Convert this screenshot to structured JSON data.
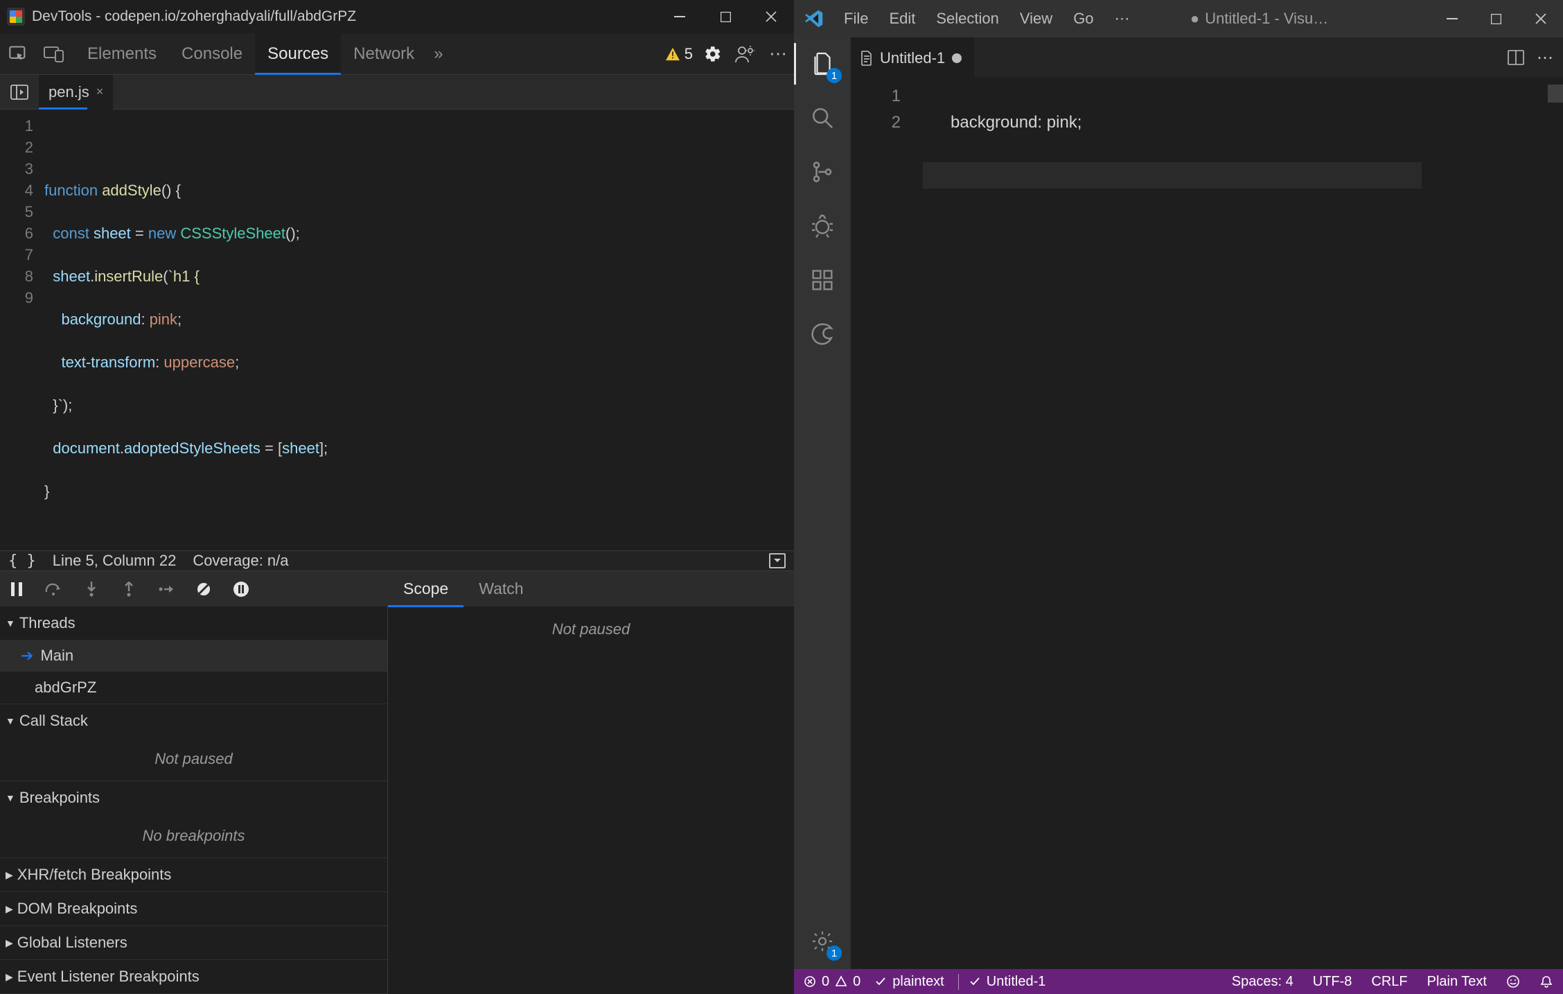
{
  "devtools": {
    "titlebar_title": "DevTools - codepen.io/zoherghadyali/full/abdGrPZ",
    "toolbar": {
      "tabs": [
        "Elements",
        "Console",
        "Sources",
        "Network"
      ],
      "active_tab": "Sources",
      "issue_count": "5",
      "more_glyph": "»"
    },
    "file_tab": "pen.js",
    "editor_lines": [
      "1",
      "2",
      "3",
      "4",
      "5",
      "6",
      "7",
      "8",
      "9"
    ],
    "code": {
      "l2_fn_kw": "function",
      "l2_fn_name": "addStyle",
      "l2_rest": "() {",
      "l3_const": "const",
      "l3_sheet": "sheet",
      "l3_eq": "=",
      "l3_new": "new",
      "l3_cls": "CSSStyleSheet",
      "l3_end": "();",
      "l4_obj": "sheet",
      "l4_dot": ".",
      "l4_fn": "insertRule",
      "l4_open": "(`",
      "l4_sel": "h1 {",
      "l5_key": "background",
      "l5_colon": ": ",
      "l5_val": "pink",
      "l5_semi": ";",
      "l6_key": "text-transform",
      "l6_colon": ": ",
      "l6_val": "uppercase",
      "l6_semi": ";",
      "l7": " }`);",
      "l8_doc": "document",
      "l8_dot": ".",
      "l8_prop": "adoptedStyleSheets",
      "l8_eq": " = [",
      "l8_sheet": "sheet",
      "l8_end": "];",
      "l9": "}"
    },
    "statusbar": {
      "braces": "{ }",
      "pos": "Line 5, Column 22",
      "coverage": "Coverage: n/a"
    },
    "scope_tabs": [
      "Scope",
      "Watch"
    ],
    "scope_msg": "Not paused",
    "panes": {
      "threads_label": "Threads",
      "threads_items": [
        "Main",
        "abdGrPZ"
      ],
      "callstack_label": "Call Stack",
      "callstack_msg": "Not paused",
      "breakpoints_label": "Breakpoints",
      "breakpoints_msg": "No breakpoints",
      "xhr_label": "XHR/fetch Breakpoints",
      "dom_label": "DOM Breakpoints",
      "global_label": "Global Listeners",
      "eventlistener_label": "Event Listener Breakpoints"
    }
  },
  "vscode": {
    "menus": [
      "File",
      "Edit",
      "Selection",
      "View",
      "Go"
    ],
    "menu_more": "⋯",
    "title_prefix": "●",
    "title_text": "Untitled-1 - Visu…",
    "file_tab": "Untitled-1",
    "activity_badge": "1",
    "gear_badge": "1",
    "editor_lines": [
      "1",
      "2"
    ],
    "code_l1": "      background: pink;",
    "status": {
      "err": "0",
      "warn": "0",
      "plaintext": "plaintext",
      "untitled": "Untitled-1",
      "spaces": "Spaces: 4",
      "encoding": "UTF-8",
      "eol": "CRLF",
      "lang": "Plain Text"
    }
  }
}
